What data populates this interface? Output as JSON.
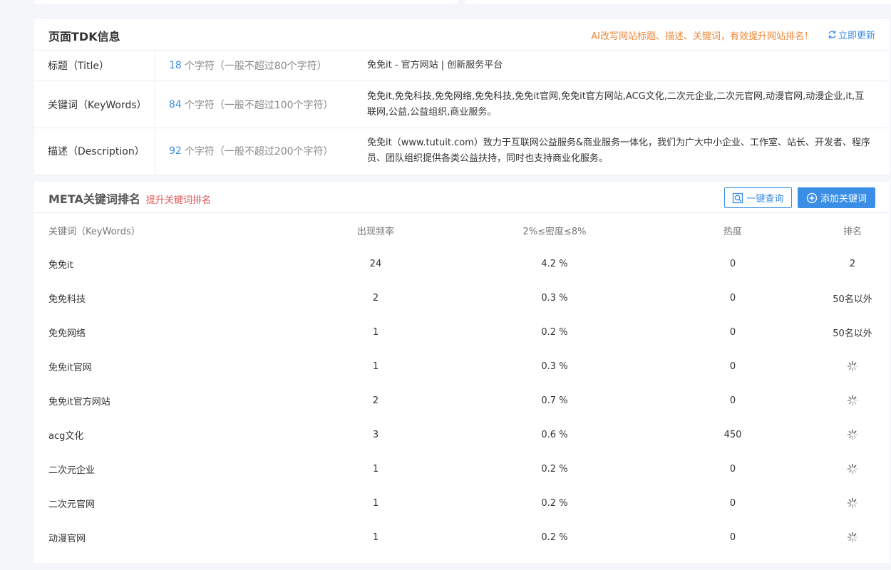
{
  "tdk": {
    "title": "页面TDK信息",
    "promo": "AI改写网站标题、描述、关键词，有效提升网站排名！",
    "refresh_label": "立即更新",
    "count_suffix_title": "个字符（一般不超过80个字符）",
    "count_suffix_keywords": "个字符（一般不超过100个字符）",
    "count_suffix_desc": "个字符（一般不超过200个字符）",
    "rows": [
      {
        "label": "标题（Title）",
        "count": "18",
        "value": "免免it - 官方网站 | 创新服务平台"
      },
      {
        "label": "关键词（KeyWords）",
        "count": "84",
        "value": "免免it,免免科技,免免网络,免免科技,免免it官网,免免it官方网站,ACG文化,二次元企业,二次元官网,动漫官网,动漫企业,it,互联网,公益,公益组织,商业服务。"
      },
      {
        "label": "描述（Description）",
        "count": "92",
        "value": "免免it（www.tutuit.com）致力于互联网公益服务&商业服务一体化，我们为广大中小企业、工作室、站长、开发者、程序员、团队组织提供各类公益扶持，同时也支持商业化服务。"
      }
    ]
  },
  "meta": {
    "title": "META关键词排名",
    "subtitle": "提升关键词排名",
    "query_button": "一键查询",
    "add_button": "添加关键词",
    "columns": [
      "关键词（KeyWords）",
      "出现频率",
      "2%≤密度≤8%",
      "热度",
      "排名"
    ],
    "rows": [
      {
        "keyword": "免免it",
        "freq": "24",
        "density": "4.2 %",
        "heat": "0",
        "rank": "2"
      },
      {
        "keyword": "免免科技",
        "freq": "2",
        "density": "0.3 %",
        "heat": "0",
        "rank": "50名以外"
      },
      {
        "keyword": "免免网络",
        "freq": "1",
        "density": "0.2 %",
        "heat": "0",
        "rank": "50名以外"
      },
      {
        "keyword": "免免it官网",
        "freq": "1",
        "density": "0.3 %",
        "heat": "0",
        "rank": ""
      },
      {
        "keyword": "免免it官方网站",
        "freq": "2",
        "density": "0.7 %",
        "heat": "0",
        "rank": ""
      },
      {
        "keyword": "acg文化",
        "freq": "3",
        "density": "0.6 %",
        "heat": "450",
        "rank": ""
      },
      {
        "keyword": "二次元企业",
        "freq": "1",
        "density": "0.2 %",
        "heat": "0",
        "rank": ""
      },
      {
        "keyword": "二次元官网",
        "freq": "1",
        "density": "0.2 %",
        "heat": "0",
        "rank": ""
      },
      {
        "keyword": "动漫官网",
        "freq": "1",
        "density": "0.2 %",
        "heat": "0",
        "rank": ""
      }
    ]
  },
  "colors": {
    "accent": "#3a8ee6",
    "promo": "#f0883a",
    "alert": "#e55353",
    "border": "#ebeef2",
    "background": "#f4f6f9"
  }
}
